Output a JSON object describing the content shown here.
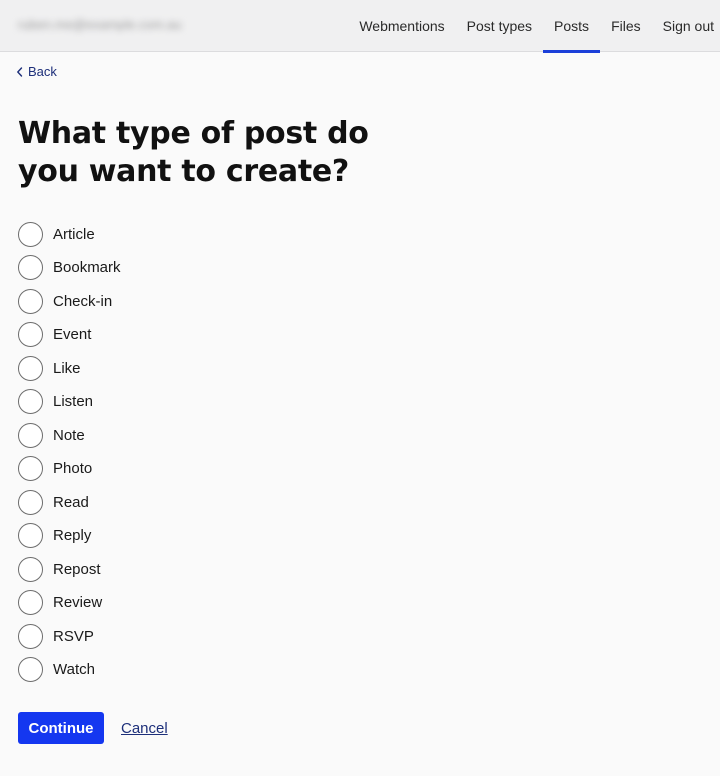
{
  "header": {
    "account": "ruben.me@example.com.au",
    "nav": [
      {
        "label": "Webmentions",
        "active": false
      },
      {
        "label": "Post types",
        "active": false
      },
      {
        "label": "Posts",
        "active": true
      },
      {
        "label": "Files",
        "active": false
      },
      {
        "label": "Sign out",
        "active": false
      }
    ]
  },
  "back": {
    "label": "Back",
    "icon": "chevron-left-icon"
  },
  "form": {
    "heading": "What type of post do you want to create?",
    "options": [
      {
        "label": "Article",
        "selected": false
      },
      {
        "label": "Bookmark",
        "selected": false
      },
      {
        "label": "Check-in",
        "selected": false
      },
      {
        "label": "Event",
        "selected": false
      },
      {
        "label": "Like",
        "selected": false
      },
      {
        "label": "Listen",
        "selected": false
      },
      {
        "label": "Note",
        "selected": false
      },
      {
        "label": "Photo",
        "selected": false
      },
      {
        "label": "Read",
        "selected": false
      },
      {
        "label": "Reply",
        "selected": false
      },
      {
        "label": "Repost",
        "selected": false
      },
      {
        "label": "Review",
        "selected": false
      },
      {
        "label": "RSVP",
        "selected": false
      },
      {
        "label": "Watch",
        "selected": false
      }
    ],
    "continue_label": "Continue",
    "cancel_label": "Cancel"
  },
  "colors": {
    "accent": "#1437f0",
    "nav_underline": "#1b3fd9",
    "link": "#1d2f7a",
    "header_bg": "#f0f0f1",
    "page_bg": "#fafafa"
  }
}
